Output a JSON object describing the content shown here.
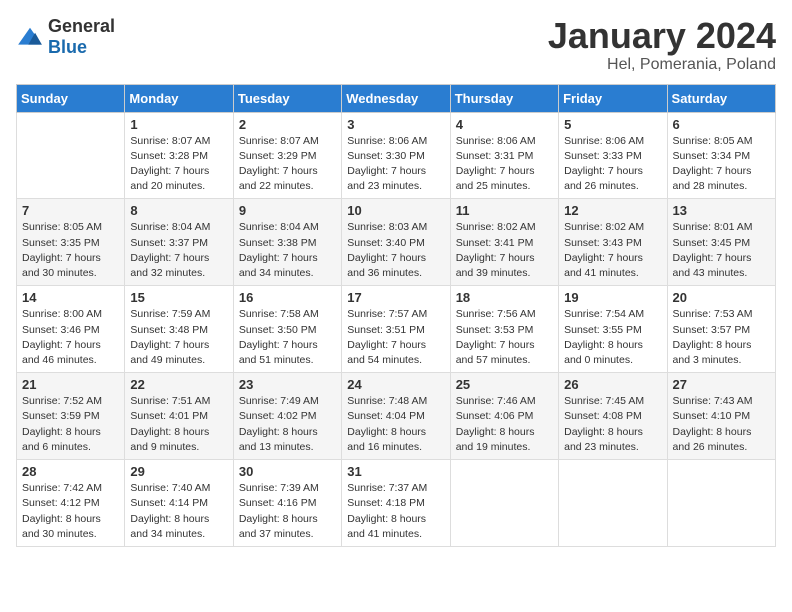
{
  "header": {
    "logo": {
      "general": "General",
      "blue": "Blue"
    },
    "title": "January 2024",
    "location": "Hel, Pomerania, Poland"
  },
  "weekdays": [
    "Sunday",
    "Monday",
    "Tuesday",
    "Wednesday",
    "Thursday",
    "Friday",
    "Saturday"
  ],
  "weeks": [
    [
      {
        "day": null,
        "info": null
      },
      {
        "day": "1",
        "info": "Sunrise: 8:07 AM\nSunset: 3:28 PM\nDaylight: 7 hours\nand 20 minutes."
      },
      {
        "day": "2",
        "info": "Sunrise: 8:07 AM\nSunset: 3:29 PM\nDaylight: 7 hours\nand 22 minutes."
      },
      {
        "day": "3",
        "info": "Sunrise: 8:06 AM\nSunset: 3:30 PM\nDaylight: 7 hours\nand 23 minutes."
      },
      {
        "day": "4",
        "info": "Sunrise: 8:06 AM\nSunset: 3:31 PM\nDaylight: 7 hours\nand 25 minutes."
      },
      {
        "day": "5",
        "info": "Sunrise: 8:06 AM\nSunset: 3:33 PM\nDaylight: 7 hours\nand 26 minutes."
      },
      {
        "day": "6",
        "info": "Sunrise: 8:05 AM\nSunset: 3:34 PM\nDaylight: 7 hours\nand 28 minutes."
      }
    ],
    [
      {
        "day": "7",
        "info": "Sunrise: 8:05 AM\nSunset: 3:35 PM\nDaylight: 7 hours\nand 30 minutes."
      },
      {
        "day": "8",
        "info": "Sunrise: 8:04 AM\nSunset: 3:37 PM\nDaylight: 7 hours\nand 32 minutes."
      },
      {
        "day": "9",
        "info": "Sunrise: 8:04 AM\nSunset: 3:38 PM\nDaylight: 7 hours\nand 34 minutes."
      },
      {
        "day": "10",
        "info": "Sunrise: 8:03 AM\nSunset: 3:40 PM\nDaylight: 7 hours\nand 36 minutes."
      },
      {
        "day": "11",
        "info": "Sunrise: 8:02 AM\nSunset: 3:41 PM\nDaylight: 7 hours\nand 39 minutes."
      },
      {
        "day": "12",
        "info": "Sunrise: 8:02 AM\nSunset: 3:43 PM\nDaylight: 7 hours\nand 41 minutes."
      },
      {
        "day": "13",
        "info": "Sunrise: 8:01 AM\nSunset: 3:45 PM\nDaylight: 7 hours\nand 43 minutes."
      }
    ],
    [
      {
        "day": "14",
        "info": "Sunrise: 8:00 AM\nSunset: 3:46 PM\nDaylight: 7 hours\nand 46 minutes."
      },
      {
        "day": "15",
        "info": "Sunrise: 7:59 AM\nSunset: 3:48 PM\nDaylight: 7 hours\nand 49 minutes."
      },
      {
        "day": "16",
        "info": "Sunrise: 7:58 AM\nSunset: 3:50 PM\nDaylight: 7 hours\nand 51 minutes."
      },
      {
        "day": "17",
        "info": "Sunrise: 7:57 AM\nSunset: 3:51 PM\nDaylight: 7 hours\nand 54 minutes."
      },
      {
        "day": "18",
        "info": "Sunrise: 7:56 AM\nSunset: 3:53 PM\nDaylight: 7 hours\nand 57 minutes."
      },
      {
        "day": "19",
        "info": "Sunrise: 7:54 AM\nSunset: 3:55 PM\nDaylight: 8 hours\nand 0 minutes."
      },
      {
        "day": "20",
        "info": "Sunrise: 7:53 AM\nSunset: 3:57 PM\nDaylight: 8 hours\nand 3 minutes."
      }
    ],
    [
      {
        "day": "21",
        "info": "Sunrise: 7:52 AM\nSunset: 3:59 PM\nDaylight: 8 hours\nand 6 minutes."
      },
      {
        "day": "22",
        "info": "Sunrise: 7:51 AM\nSunset: 4:01 PM\nDaylight: 8 hours\nand 9 minutes."
      },
      {
        "day": "23",
        "info": "Sunrise: 7:49 AM\nSunset: 4:02 PM\nDaylight: 8 hours\nand 13 minutes."
      },
      {
        "day": "24",
        "info": "Sunrise: 7:48 AM\nSunset: 4:04 PM\nDaylight: 8 hours\nand 16 minutes."
      },
      {
        "day": "25",
        "info": "Sunrise: 7:46 AM\nSunset: 4:06 PM\nDaylight: 8 hours\nand 19 minutes."
      },
      {
        "day": "26",
        "info": "Sunrise: 7:45 AM\nSunset: 4:08 PM\nDaylight: 8 hours\nand 23 minutes."
      },
      {
        "day": "27",
        "info": "Sunrise: 7:43 AM\nSunset: 4:10 PM\nDaylight: 8 hours\nand 26 minutes."
      }
    ],
    [
      {
        "day": "28",
        "info": "Sunrise: 7:42 AM\nSunset: 4:12 PM\nDaylight: 8 hours\nand 30 minutes."
      },
      {
        "day": "29",
        "info": "Sunrise: 7:40 AM\nSunset: 4:14 PM\nDaylight: 8 hours\nand 34 minutes."
      },
      {
        "day": "30",
        "info": "Sunrise: 7:39 AM\nSunset: 4:16 PM\nDaylight: 8 hours\nand 37 minutes."
      },
      {
        "day": "31",
        "info": "Sunrise: 7:37 AM\nSunset: 4:18 PM\nDaylight: 8 hours\nand 41 minutes."
      },
      {
        "day": null,
        "info": null
      },
      {
        "day": null,
        "info": null
      },
      {
        "day": null,
        "info": null
      }
    ]
  ]
}
